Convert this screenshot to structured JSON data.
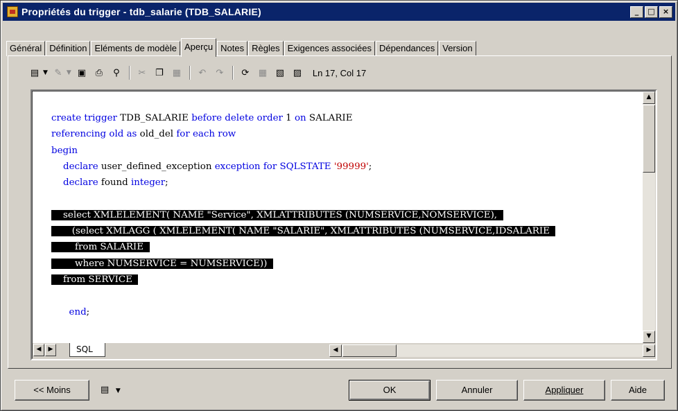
{
  "window": {
    "title": "Propriétés du trigger - tdb_salarie (TDB_SALARIE)",
    "controls": {
      "minimize": "_",
      "maximize": "□",
      "close": "×"
    }
  },
  "tabs": [
    {
      "label": "Général"
    },
    {
      "label": "Définition"
    },
    {
      "label": "Eléments de modèle"
    },
    {
      "label": "Aperçu",
      "active": true
    },
    {
      "label": "Notes"
    },
    {
      "label": "Règles"
    },
    {
      "label": "Exigences associées"
    },
    {
      "label": "Dépendances"
    },
    {
      "label": "Version"
    }
  ],
  "toolbar": {
    "status": "Ln 17, Col 17",
    "icons": [
      "properties-icon",
      "edit-icon",
      "save-icon",
      "print-icon",
      "find-icon",
      "cut-icon",
      "copy-icon",
      "paste-icon",
      "undo-icon",
      "redo-icon",
      "refresh-icon",
      "grid-icon",
      "edit-table-icon",
      "export-icon"
    ]
  },
  "code": {
    "lines": [
      "create trigger TDB_SALARIE before delete order 1 on SALARIE",
      "referencing old as old_del for each row",
      "begin",
      "    declare user_defined_exception exception for SQLSTATE '99999';",
      "    declare found integer;",
      "",
      "    select XMLELEMENT( NAME \"Service\", XMLATTRIBUTES (NUMSERVICE,NOMSERVICE),",
      "       (select XMLAGG ( XMLELEMENT( NAME \"SALARIE\", XMLATTRIBUTES (NUMSERVICE,IDSALARIE",
      "        from SALARIE",
      "        where NUMSERVICE = NUMSERVICE))",
      "    from SERVICE",
      "",
      "      end;"
    ],
    "selected_lines": [
      6,
      7,
      8,
      9,
      10
    ]
  },
  "editor": {
    "sheet_tab": "SQL"
  },
  "buttons": {
    "less": "<< Moins",
    "ok": "OK",
    "cancel": "Annuler",
    "apply": "Appliquer",
    "help": "Aide"
  }
}
